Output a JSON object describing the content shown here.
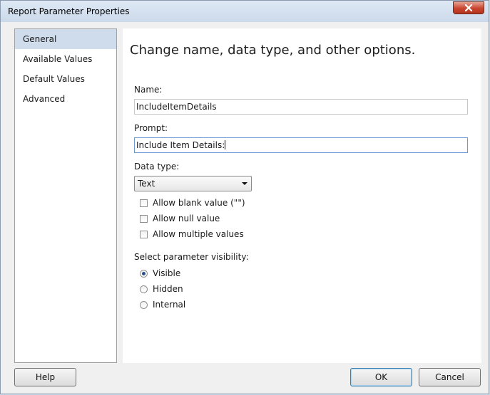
{
  "window": {
    "title": "Report Parameter Properties"
  },
  "sidebar": {
    "items": [
      {
        "label": "General",
        "selected": true
      },
      {
        "label": "Available Values",
        "selected": false
      },
      {
        "label": "Default Values",
        "selected": false
      },
      {
        "label": "Advanced",
        "selected": false
      }
    ]
  },
  "main": {
    "heading": "Change name, data type, and other options.",
    "name_label": "Name:",
    "name_value": "IncludeItemDetails",
    "prompt_label": "Prompt:",
    "prompt_value": "Include Item Details:",
    "datatype_label": "Data type:",
    "datatype_value": "Text",
    "checkboxes": [
      {
        "label": "Allow blank value (\"\")",
        "checked": false
      },
      {
        "label": "Allow null value",
        "checked": false
      },
      {
        "label": "Allow multiple values",
        "checked": false
      }
    ],
    "visibility_label": "Select parameter visibility:",
    "visibility_options": [
      {
        "label": "Visible",
        "selected": true
      },
      {
        "label": "Hidden",
        "selected": false
      },
      {
        "label": "Internal",
        "selected": false
      }
    ]
  },
  "footer": {
    "help": "Help",
    "ok": "OK",
    "cancel": "Cancel"
  },
  "icons": {
    "close": "close-icon",
    "dropdown": "chevron-down-icon"
  },
  "colors": {
    "selection": "#cfdceb",
    "close_button": "#c8452f",
    "focus_border": "#6b9bd1"
  }
}
